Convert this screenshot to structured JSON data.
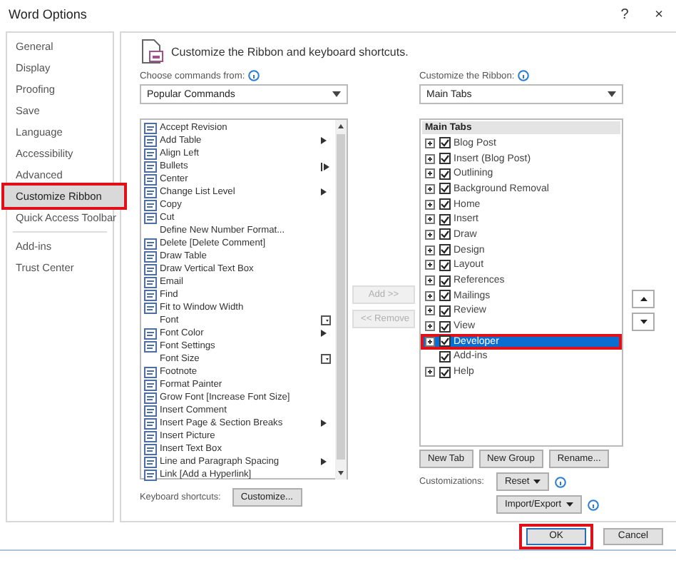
{
  "window": {
    "title": "Word Options",
    "help": "?",
    "close": "×"
  },
  "sidebar": {
    "sections": [
      {
        "items": [
          {
            "label": "General",
            "selected": false,
            "highlighted": false
          },
          {
            "label": "Display",
            "selected": false,
            "highlighted": false
          },
          {
            "label": "Proofing",
            "selected": false,
            "highlighted": false
          },
          {
            "label": "Save",
            "selected": false,
            "highlighted": false
          },
          {
            "label": "Language",
            "selected": false,
            "highlighted": false
          },
          {
            "label": "Accessibility",
            "selected": false,
            "highlighted": false
          },
          {
            "label": "Advanced",
            "selected": false,
            "highlighted": false
          },
          {
            "label": "Customize Ribbon",
            "selected": true,
            "highlighted": true
          },
          {
            "label": "Quick Access Toolbar",
            "selected": false,
            "highlighted": false
          }
        ]
      },
      {
        "items": [
          {
            "label": "Add-ins",
            "selected": false,
            "highlighted": false
          },
          {
            "label": "Trust Center",
            "selected": false,
            "highlighted": false
          }
        ]
      }
    ]
  },
  "heading": "Customize the Ribbon and keyboard shortcuts.",
  "commands": {
    "label": "Choose commands from:",
    "dropdown": "Popular Commands",
    "items": [
      {
        "label": "Accept Revision",
        "kind": "plain",
        "has_icon": true
      },
      {
        "label": "Add Table",
        "kind": "submenu",
        "has_icon": true
      },
      {
        "label": "Align Left",
        "kind": "plain",
        "has_icon": true
      },
      {
        "label": "Bullets",
        "kind": "split",
        "has_icon": true
      },
      {
        "label": "Center",
        "kind": "plain",
        "has_icon": true
      },
      {
        "label": "Change List Level",
        "kind": "submenu",
        "has_icon": true
      },
      {
        "label": "Copy",
        "kind": "plain",
        "has_icon": true
      },
      {
        "label": "Cut",
        "kind": "plain",
        "has_icon": true
      },
      {
        "label": "Define New Number Format...",
        "kind": "plain",
        "has_icon": false
      },
      {
        "label": "Delete [Delete Comment]",
        "kind": "plain",
        "has_icon": true
      },
      {
        "label": "Draw Table",
        "kind": "plain",
        "has_icon": true
      },
      {
        "label": "Draw Vertical Text Box",
        "kind": "plain",
        "has_icon": true
      },
      {
        "label": "Email",
        "kind": "plain",
        "has_icon": true
      },
      {
        "label": "Find",
        "kind": "plain",
        "has_icon": true
      },
      {
        "label": "Fit to Window Width",
        "kind": "plain",
        "has_icon": true
      },
      {
        "label": "Font",
        "kind": "combo",
        "has_icon": false
      },
      {
        "label": "Font Color",
        "kind": "submenu",
        "has_icon": true
      },
      {
        "label": "Font Settings",
        "kind": "plain",
        "has_icon": true
      },
      {
        "label": "Font Size",
        "kind": "combo",
        "has_icon": false
      },
      {
        "label": "Footnote",
        "kind": "plain",
        "has_icon": true
      },
      {
        "label": "Format Painter",
        "kind": "plain",
        "has_icon": true
      },
      {
        "label": "Grow Font [Increase Font Size]",
        "kind": "plain",
        "has_icon": true
      },
      {
        "label": "Insert Comment",
        "kind": "plain",
        "has_icon": true
      },
      {
        "label": "Insert Page & Section Breaks",
        "kind": "submenu",
        "has_icon": true
      },
      {
        "label": "Insert Picture",
        "kind": "plain",
        "has_icon": true
      },
      {
        "label": "Insert Text Box",
        "kind": "plain",
        "has_icon": true
      },
      {
        "label": "Line and Paragraph Spacing",
        "kind": "submenu",
        "has_icon": true
      },
      {
        "label": "Link [Add a Hyperlink]",
        "kind": "plain",
        "has_icon": true
      }
    ],
    "shortcuts_label": "Keyboard shortcuts:",
    "customize_button": "Customize..."
  },
  "add_button": {
    "label": "Add >>",
    "disabled": true
  },
  "remove_button": {
    "label": "<< Remove",
    "disabled": true
  },
  "ribbon": {
    "label": "Customize the Ribbon:",
    "dropdown": "Main Tabs",
    "header": "Main Tabs",
    "items": [
      {
        "label": "Blog Post",
        "expandable": true,
        "checked": true,
        "selected": false,
        "highlighted": false
      },
      {
        "label": "Insert (Blog Post)",
        "expandable": true,
        "checked": true,
        "selected": false,
        "highlighted": false
      },
      {
        "label": "Outlining",
        "expandable": true,
        "checked": true,
        "selected": false,
        "highlighted": false
      },
      {
        "label": "Background Removal",
        "expandable": true,
        "checked": true,
        "selected": false,
        "highlighted": false
      },
      {
        "label": "Home",
        "expandable": true,
        "checked": true,
        "selected": false,
        "highlighted": false
      },
      {
        "label": "Insert",
        "expandable": true,
        "checked": true,
        "selected": false,
        "highlighted": false
      },
      {
        "label": "Draw",
        "expandable": true,
        "checked": true,
        "selected": false,
        "highlighted": false
      },
      {
        "label": "Design",
        "expandable": true,
        "checked": true,
        "selected": false,
        "highlighted": false
      },
      {
        "label": "Layout",
        "expandable": true,
        "checked": true,
        "selected": false,
        "highlighted": false
      },
      {
        "label": "References",
        "expandable": true,
        "checked": true,
        "selected": false,
        "highlighted": false
      },
      {
        "label": "Mailings",
        "expandable": true,
        "checked": true,
        "selected": false,
        "highlighted": false
      },
      {
        "label": "Review",
        "expandable": true,
        "checked": true,
        "selected": false,
        "highlighted": false
      },
      {
        "label": "View",
        "expandable": true,
        "checked": true,
        "selected": false,
        "highlighted": false
      },
      {
        "label": "Developer",
        "expandable": true,
        "checked": true,
        "selected": true,
        "highlighted": true
      },
      {
        "label": "Add-ins",
        "expandable": false,
        "checked": true,
        "selected": false,
        "highlighted": false
      },
      {
        "label": "Help",
        "expandable": true,
        "checked": true,
        "selected": false,
        "highlighted": false
      }
    ],
    "new_tab": "New Tab",
    "new_group": "New Group",
    "rename": "Rename...",
    "customizations_label": "Customizations:",
    "reset": "Reset",
    "import_export": "Import/Export"
  },
  "footer": {
    "buttons": [
      {
        "label": "OK",
        "highlighted": true
      },
      {
        "label": "Cancel",
        "highlighted": false
      }
    ]
  }
}
